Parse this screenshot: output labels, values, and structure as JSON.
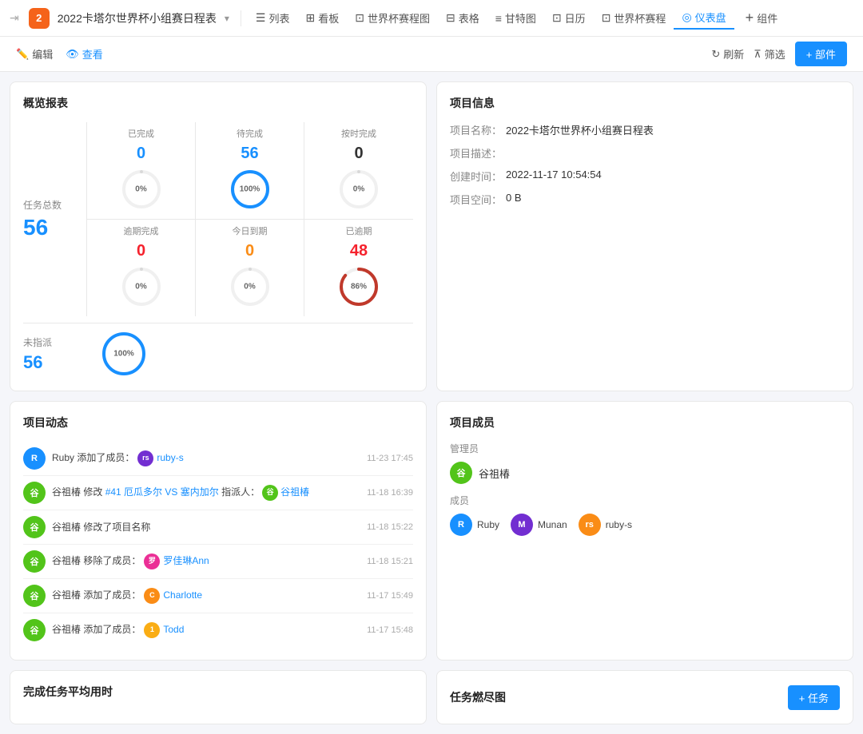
{
  "topNav": {
    "logoText": "2",
    "title": "2022卡塔尔世界杯小组赛日程表",
    "titleArrow": "▾",
    "items": [
      {
        "id": "list",
        "icon": "☰",
        "label": "列表"
      },
      {
        "id": "kanban",
        "icon": "⊞",
        "label": "看板"
      },
      {
        "id": "worldcup-chart",
        "icon": "⊡",
        "label": "世界杯赛程图"
      },
      {
        "id": "table",
        "icon": "⊟",
        "label": "表格"
      },
      {
        "id": "gantt",
        "icon": "≡",
        "label": "甘特图"
      },
      {
        "id": "calendar",
        "icon": "⊡",
        "label": "日历"
      },
      {
        "id": "worldcup",
        "icon": "⊡",
        "label": "世界杯赛程"
      },
      {
        "id": "dashboard",
        "icon": "◎",
        "label": "仪表盘",
        "active": true
      },
      {
        "id": "components",
        "icon": "+",
        "label": "组件"
      }
    ]
  },
  "subToolbar": {
    "editLabel": "编辑",
    "viewerLabel": "查看",
    "refreshLabel": "刷新",
    "filterLabel": "筛选",
    "addPartLabel": "+ 部件"
  },
  "overviewCard": {
    "title": "概览报表",
    "totalLabel": "任务总数",
    "totalNum": "56",
    "stats": [
      {
        "label": "已完成",
        "num": "0",
        "pct": "0%",
        "color": "blue",
        "strokeColor": "#d9d9d9",
        "pctVal": 0
      },
      {
        "label": "待完成",
        "num": "56",
        "pct": "100%",
        "color": "blue",
        "strokeColor": "#1890ff",
        "pctVal": 100
      },
      {
        "label": "按时完成",
        "num": "0",
        "pct": "0%",
        "color": "black",
        "strokeColor": "#d9d9d9",
        "pctVal": 0
      },
      {
        "label": "逾期完成",
        "num": "0",
        "pct": "0%",
        "color": "red",
        "strokeColor": "#d9d9d9",
        "pctVal": 0
      },
      {
        "label": "今日到期",
        "num": "0",
        "pct": "0%",
        "color": "orange",
        "strokeColor": "#d9d9d9",
        "pctVal": 0
      },
      {
        "label": "已逾期",
        "num": "48",
        "pct": "86%",
        "color": "red",
        "strokeColor": "#c0392b",
        "pctVal": 86
      }
    ],
    "unassignedLabel": "未指派",
    "unassignedNum": "56",
    "unassignedPct": "100%",
    "unassignedPctVal": 100
  },
  "projectInfo": {
    "title": "项目信息",
    "nameLabel": "项目名称：",
    "nameValue": "2022卡塔尔世界杯小组赛日程表",
    "descLabel": "项目描述：",
    "descValue": "",
    "createTimeLabel": "创建时间：",
    "createTimeValue": "2022-11-17 10:54:54",
    "spaceLabel": "项目空间：",
    "spaceValue": "0 B"
  },
  "activityCard": {
    "title": "项目动态",
    "items": [
      {
        "user": "Ruby",
        "avatarColor": "blue",
        "avatarText": "R",
        "action": "添加了成员：",
        "target": "ruby-s",
        "targetAvatar": "rs",
        "targetAvatarColor": "purple",
        "time": "11-23 17:45"
      },
      {
        "user": "谷祖椿",
        "avatarColor": "green",
        "avatarText": "谷",
        "action": "修改",
        "target": "#41 厄瓜多尔 VS 塞内加尔",
        "extra": "指派人：",
        "extraUser": "谷祖椿",
        "time": "11-18 16:39"
      },
      {
        "user": "谷祖椿",
        "avatarColor": "green",
        "avatarText": "谷",
        "action": "修改了项目名称",
        "target": "",
        "time": "11-18 15:22"
      },
      {
        "user": "谷祖椿",
        "avatarColor": "green",
        "avatarText": "谷",
        "action": "移除了成员：",
        "target": "罗佳琳Ann",
        "targetAvatarColor": "pink",
        "targetAvatarText": "罗",
        "time": "11-18 15:21"
      },
      {
        "user": "谷祖椿",
        "avatarColor": "green",
        "avatarText": "谷",
        "action": "添加了成员：",
        "target": "Charlotte",
        "targetAvatarColor": "orange",
        "targetAvatarText": "C",
        "time": "11-17 15:49"
      },
      {
        "user": "谷祖椿",
        "avatarColor": "green",
        "avatarText": "谷",
        "action": "添加了成员：",
        "target": "Todd",
        "targetAvatarColor": "yellow",
        "targetAvatarText": "1",
        "time": "11-17 15:48"
      }
    ]
  },
  "membersCard": {
    "title": "项目成员",
    "adminLabel": "管理员",
    "adminName": "谷祖椿",
    "adminAvatarColor": "green",
    "adminAvatarText": "谷",
    "membersLabel": "成员",
    "members": [
      {
        "name": "Ruby",
        "avatarColor": "blue",
        "avatarText": "R"
      },
      {
        "name": "Munan",
        "avatarColor": "purple",
        "avatarText": "M"
      },
      {
        "name": "ruby-s",
        "avatarColor": "orange",
        "avatarText": "rs"
      }
    ]
  },
  "bottomLeft": {
    "title": "完成任务平均用时"
  },
  "bottomRight": {
    "title": "任务燃尽图",
    "addTaskLabel": "+ 任务"
  }
}
